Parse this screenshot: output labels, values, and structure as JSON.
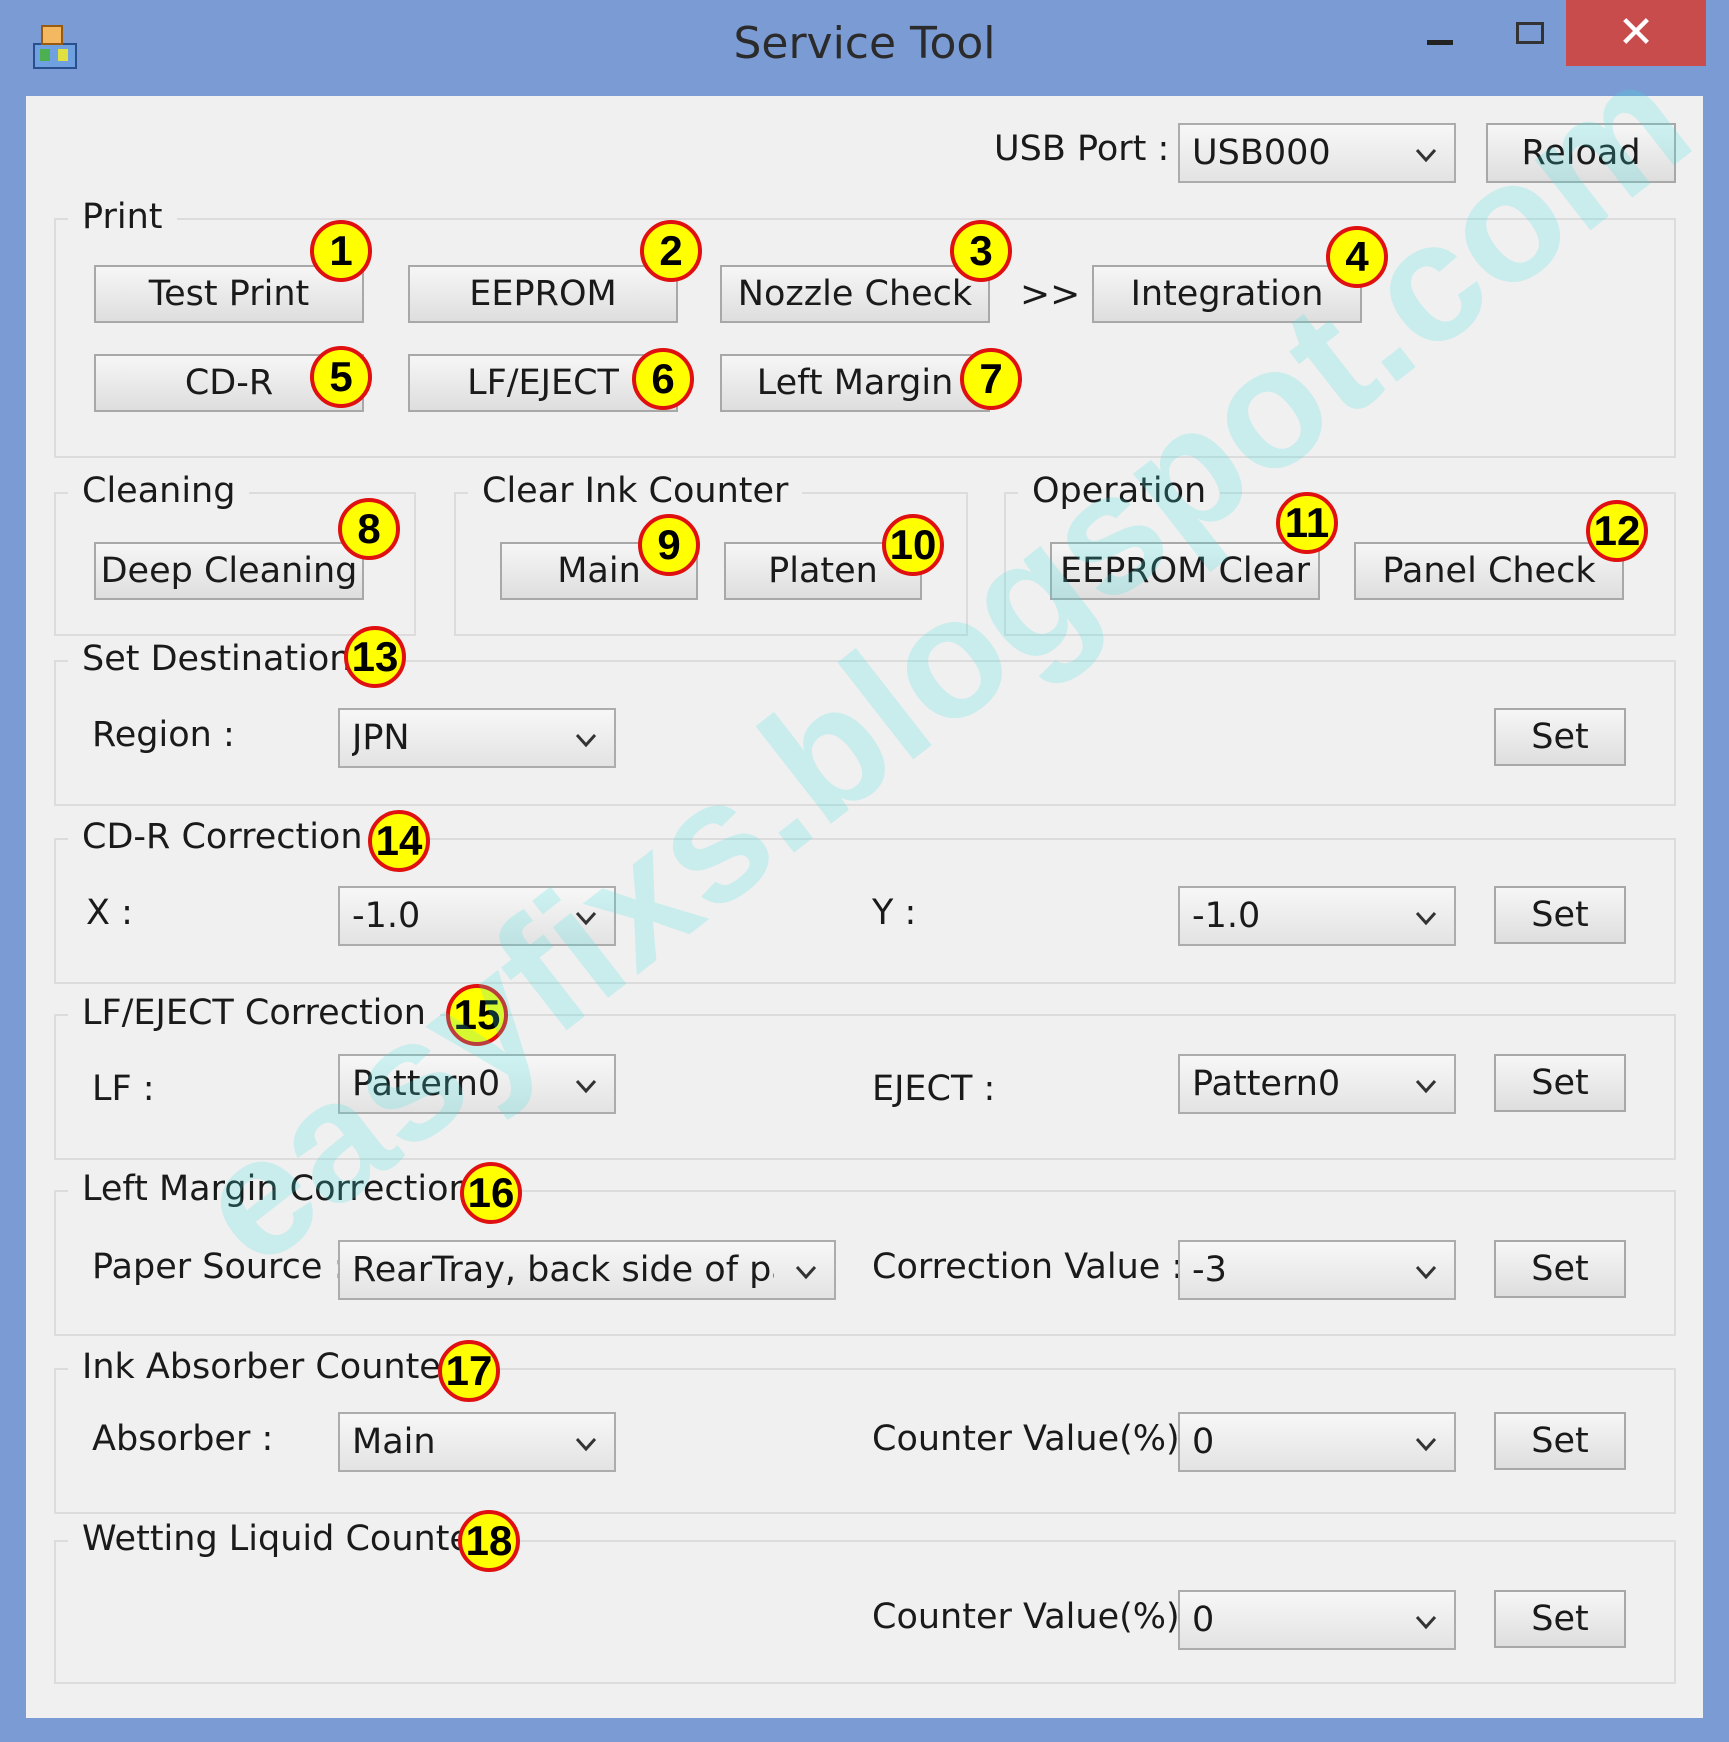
{
  "window": {
    "title": "Service Tool"
  },
  "usb": {
    "label": "USB Port :",
    "value": "USB000",
    "reload_label": "Reload"
  },
  "print": {
    "title": "Print",
    "buttons": [
      "Test Print",
      "EEPROM",
      "Nozzle Check",
      "Integration",
      "CD-R",
      "LF/EJECT",
      "Left Margin"
    ],
    "arrow": ">>"
  },
  "cleaning": {
    "title": "Cleaning",
    "deep_label": "Deep Cleaning"
  },
  "ink_counter": {
    "title": "Clear Ink Counter",
    "main_label": "Main",
    "platen_label": "Platen"
  },
  "operation": {
    "title": "Operation",
    "eeprom_clear_label": "EEPROM Clear",
    "panel_check_label": "Panel Check"
  },
  "destination": {
    "title": "Set Destination",
    "region_label": "Region :",
    "region_value": "JPN",
    "set_label": "Set"
  },
  "cdr_correction": {
    "title": "CD-R Correction",
    "x_label": "X :",
    "x_value": "-1.0",
    "y_label": "Y :",
    "y_value": "-1.0",
    "set_label": "Set"
  },
  "lf_correction": {
    "title": "LF/EJECT Correction",
    "lf_label": "LF :",
    "lf_value": "Pattern0",
    "eject_label": "EJECT :",
    "eject_value": "Pattern0",
    "set_label": "Set"
  },
  "margin_correction": {
    "title": "Left Margin Correction",
    "paper_label": "Paper Source :",
    "paper_value": "RearTray, back side of pap",
    "value_label": "Correction Value :",
    "value": "-3",
    "set_label": "Set"
  },
  "absorber": {
    "title": "Ink Absorber Counter",
    "absorber_label": "Absorber :",
    "absorber_value": "Main",
    "counter_label": "Counter Value(%) :",
    "counter_value": "0",
    "set_label": "Set"
  },
  "wetting": {
    "title": "Wetting Liquid Counter",
    "counter_label": "Counter Value(%) :",
    "counter_value": "0",
    "set_label": "Set"
  },
  "badges": [
    "1",
    "2",
    "3",
    "4",
    "5",
    "6",
    "7",
    "8",
    "9",
    "10",
    "11",
    "12",
    "13",
    "14",
    "15",
    "16",
    "17",
    "18"
  ],
  "watermark": "easyfixs.blogspot.com",
  "colors": {
    "titlebar": "#7b9bd4",
    "close": "#c94c4c",
    "badge_fill": "#ffff00",
    "badge_border": "#e01010",
    "watermark": "#40e0e0"
  }
}
